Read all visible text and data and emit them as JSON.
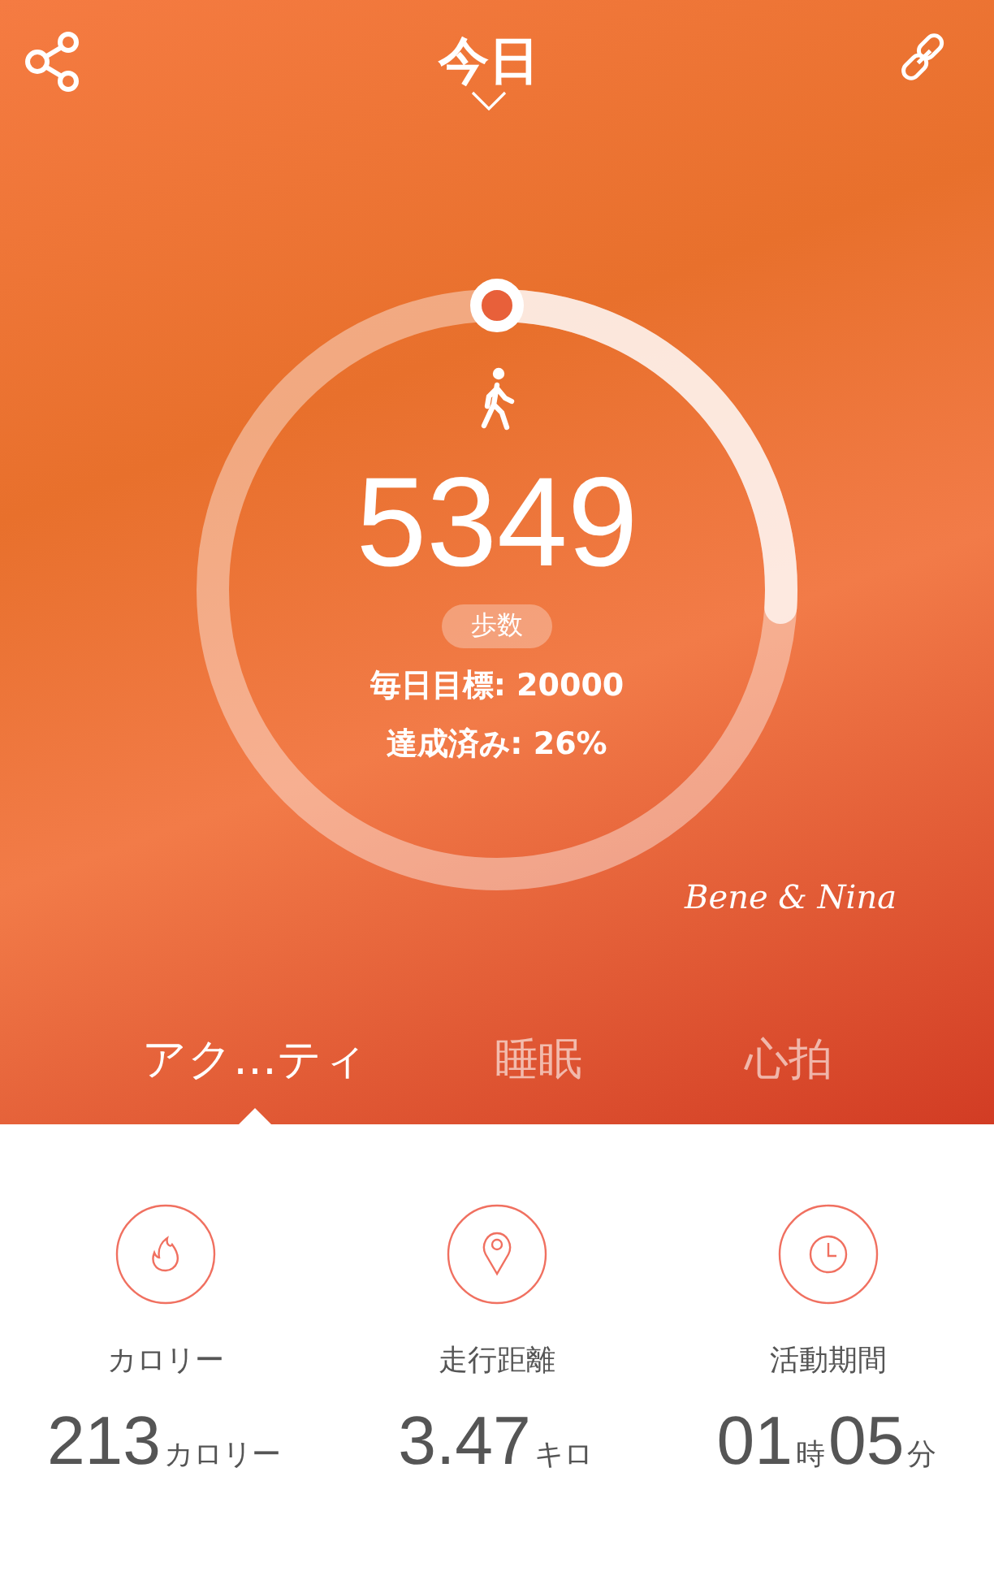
{
  "header": {
    "title": "今日"
  },
  "goal_ring": {
    "steps": "5349",
    "unit_badge": "歩数",
    "goal": "毎日目標: 20000",
    "achieved": "達成済み: 26%"
  },
  "signature": "Bene & Nina",
  "tabs": [
    {
      "label": "アク…ティ",
      "selected": true
    },
    {
      "label": "睡眠",
      "selected": false
    },
    {
      "label": "心拍",
      "selected": false
    }
  ],
  "stats": [
    {
      "kind": "flame",
      "label": "カロリー",
      "parts": [
        {
          "text": "213",
          "kind": "number"
        },
        {
          "text": "カロリー",
          "kind": "unit"
        }
      ]
    },
    {
      "kind": "pin",
      "label": "走行距離",
      "parts": [
        {
          "text": "3.47",
          "kind": "number"
        },
        {
          "text": "キロ",
          "kind": "unit"
        }
      ]
    },
    {
      "kind": "clock",
      "label": "活動期間",
      "parts": [
        {
          "text": "01",
          "kind": "number"
        },
        {
          "text": "時",
          "kind": "unit"
        },
        {
          "text": "05",
          "kind": "number"
        },
        {
          "text": "分",
          "kind": "unit"
        }
      ]
    }
  ]
}
